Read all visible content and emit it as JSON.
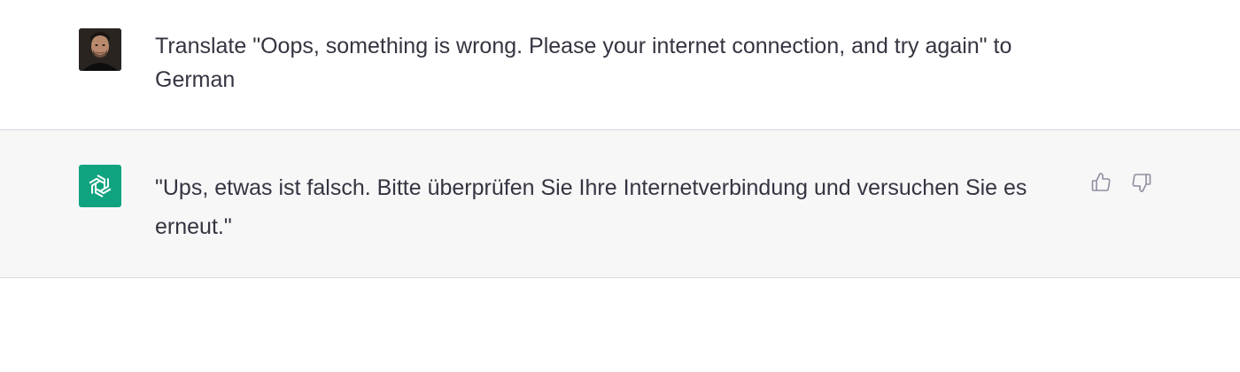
{
  "conversation": {
    "user_message": {
      "text": "Translate \"Oops, something is wrong. Please your internet connection, and try again\" to German",
      "avatar": "user-photo-avatar"
    },
    "assistant_message": {
      "text": "\"Ups, etwas ist falsch. Bitte überprüfen Sie Ihre Internetverbindung und versuchen Sie es erneut.\"",
      "avatar": "openai-logo-icon"
    },
    "feedback": {
      "like_icon": "thumbs-up-icon",
      "dislike_icon": "thumbs-down-icon"
    }
  },
  "colors": {
    "assistant_avatar_bg": "#10a37f",
    "assistant_row_bg": "#f7f7f8",
    "text": "#343541",
    "icon": "#8e8ea0",
    "divider": "#d9d9e3"
  }
}
